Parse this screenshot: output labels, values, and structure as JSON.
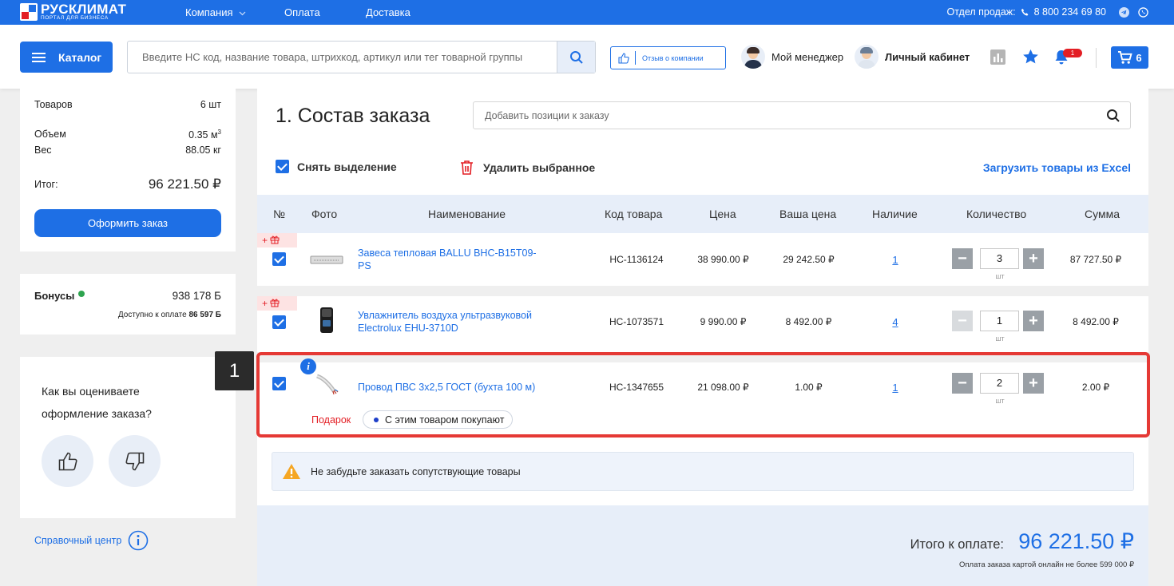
{
  "topbar": {
    "logo_name": "РУСКЛИМАТ",
    "logo_sub": "ПОРТАЛ ДЛЯ БИЗНЕСА",
    "nav": [
      "Компания",
      "Оплата",
      "Доставка"
    ],
    "sales_label": "Отдел продаж:",
    "phone": "8 800 234 69 80"
  },
  "header": {
    "catalog_label": "Каталог",
    "search_placeholder": "Введите НС код, название товара, штрихкод, артикул или тег товарной группы",
    "review_label": "Отзыв о компании",
    "manager_label": "Мой менеджер",
    "cabinet_label": "Личный кабинет",
    "notif_count": "1",
    "cart_count": "6"
  },
  "summary": {
    "goods_label": "Товаров",
    "goods_value": "6 шт",
    "volume_label": "Объем",
    "volume_value": "0.35 м",
    "volume_sup": "3",
    "weight_label": "Вес",
    "weight_value": "88.05 кг",
    "total_label": "Итог:",
    "total_value": "96 221.50 ₽",
    "order_button": "Оформить заказ"
  },
  "bonus": {
    "label": "Бонусы",
    "value": "938 178 Б",
    "available_label": "Доступно к оплате",
    "available_value": "86 597 Б"
  },
  "feedback": {
    "question": "Как вы оцениваете оформление заказа?"
  },
  "help": {
    "label": "Справочный центр"
  },
  "main": {
    "title": "1. Состав заказа",
    "add_placeholder": "Добавить позиции к заказу",
    "deselect_label": "Снять выделение",
    "delete_label": "Удалить выбранное",
    "excel_label": "Загрузить товары из Excel"
  },
  "table": {
    "headers": [
      "№",
      "Фото",
      "Наименование",
      "Код товара",
      "Цена",
      "Ваша цена",
      "Наличие",
      "Количество",
      "Сумма"
    ],
    "rows": [
      {
        "name": "Завеса тепловая BALLU BHC-B15T09-PS",
        "code": "НС-1136124",
        "price": "38 990.00 ₽",
        "your_price": "29 242.50 ₽",
        "avail": "1",
        "qty": "3",
        "unit": "шт",
        "sum": "87 727.50 ₽"
      },
      {
        "name": "Увлажнитель воздуха ультразвуковой Electrolux EHU-3710D",
        "code": "НС-1073571",
        "price": "9 990.00 ₽",
        "your_price": "8 492.00 ₽",
        "avail": "4",
        "qty": "1",
        "unit": "шт",
        "sum": "8 492.00 ₽"
      },
      {
        "name": "Провод ПВС 3х2,5 ГОСТ (бухта 100 м)",
        "code": "НС-1347655",
        "price": "21 098.00 ₽",
        "your_price": "1.00 ₽",
        "avail": "1",
        "qty": "2",
        "unit": "шт",
        "sum": "2.00 ₽",
        "gift_label": "Подарок",
        "related_label": "С этим товаром покупают"
      }
    ]
  },
  "step_badge": "1",
  "warning": "Не забудьте заказать сопутствующие товары",
  "totals": {
    "label": "Итого к оплате:",
    "value": "96 221.50 ₽",
    "note": "Оплата заказа картой онлайн не более 599 000 ₽"
  },
  "colors": {
    "accent": "#1e6fe5",
    "danger": "#e31e24",
    "highlight": "#e53935"
  }
}
